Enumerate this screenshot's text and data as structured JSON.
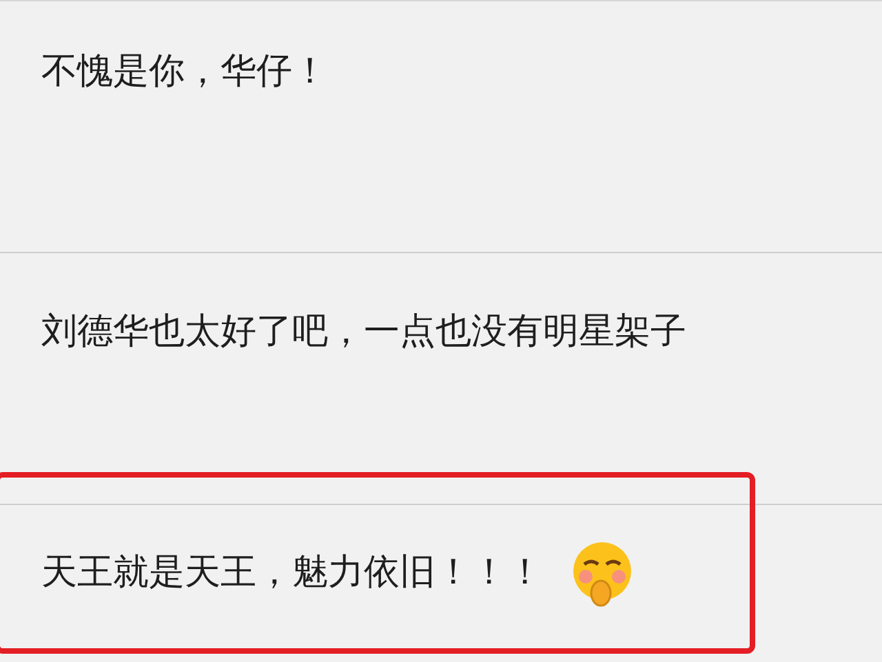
{
  "comments": [
    {
      "text": "不愧是你，华仔！",
      "highlighted": false,
      "emoji": false
    },
    {
      "text": "刘德华也太好了吧，一点也没有明星架子",
      "highlighted": false,
      "emoji": false
    },
    {
      "text": "天王就是天王，魅力依旧！！！",
      "highlighted": true,
      "emoji": true
    }
  ]
}
